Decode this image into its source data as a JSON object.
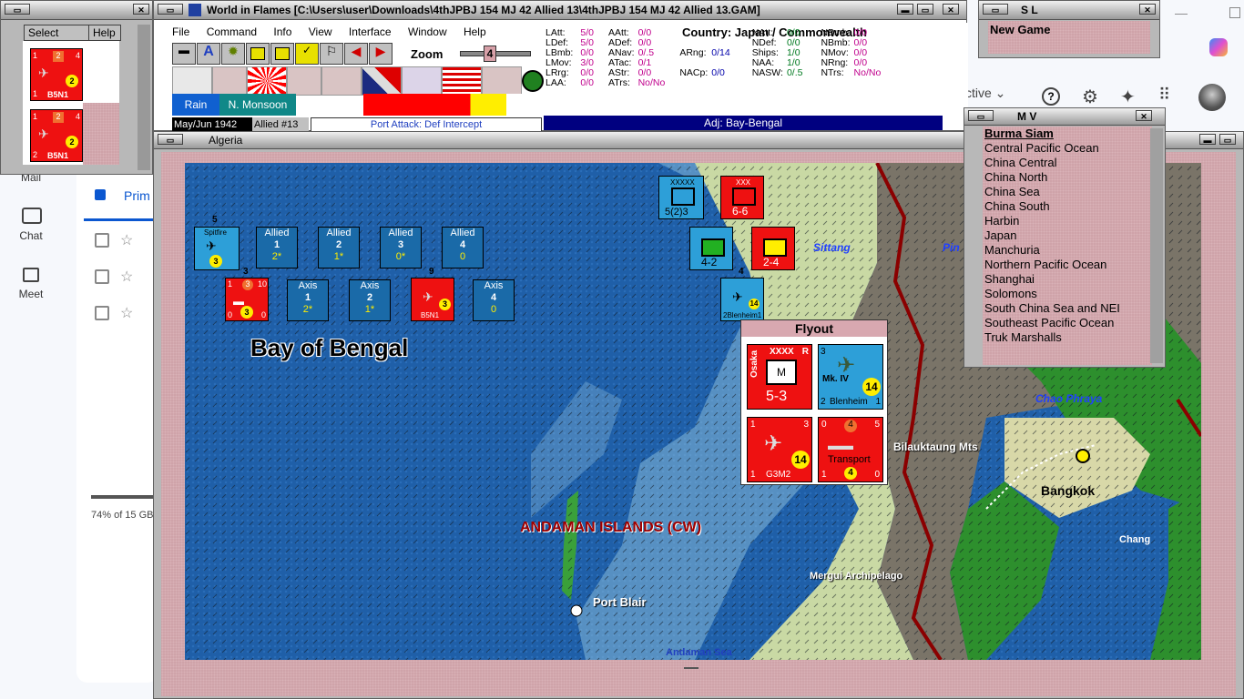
{
  "main_window": {
    "title": "World in Flames [C:\\Users\\user\\Downloads\\4thJPBJ 154 MJ 42 Allied 13\\4thJPBJ 154 MJ 42 Allied 13.GAM]",
    "menu": [
      "File",
      "Command",
      "Info",
      "View",
      "Interface",
      "Window",
      "Help"
    ],
    "zoom_label": "Zoom",
    "zoom_value": "4",
    "weather": "Rain",
    "season": "N. Monsoon",
    "date": "May/Jun 1942",
    "impulse": "Allied #13",
    "phase": "Port Attack: Def Intercept",
    "country_title": "Country: Japan / Commonwealth",
    "adj_text": "Adj: Bay-Bengal",
    "stats": [
      [
        "LAtt:",
        "5/0",
        "AAtt:",
        "0/0",
        "",
        "",
        "NAtt:",
        "0/0",
        "NBmb:",
        "0/0"
      ],
      [
        "LDef:",
        "5/0",
        "ADef:",
        "0/0",
        "",
        "",
        "NDef:",
        "0/0",
        "NBmb:",
        "0/0"
      ],
      [
        "LBmb:",
        "0/0",
        "ANav:",
        "0/.5",
        "ARng:",
        "0/14",
        "Ships:",
        "1/0",
        "NMov:",
        "0/0"
      ],
      [
        "LMov:",
        "3/0",
        "ATac:",
        "0/1",
        "",
        "",
        "NAA:",
        "1/0",
        "NRng:",
        "0/0"
      ],
      [
        "LRrg:",
        "0/0",
        "AStr:",
        "0/0",
        "NACp:",
        "0/0",
        "NASW:",
        "0/.5",
        "NTrs:",
        "No/No"
      ],
      [
        "LAA:",
        "0/0",
        "ATrs:",
        "No/No",
        "",
        "",
        "",
        "",
        "",
        ""
      ]
    ]
  },
  "select_window": {
    "select_label": "Select",
    "help_label": "Help",
    "units": [
      "B5N1",
      "B5N1"
    ]
  },
  "sl_window": {
    "title": "S L",
    "new_game": "New Game"
  },
  "mv_window": {
    "title": "M V",
    "items": [
      "Burma Siam",
      "Central Pacific Ocean",
      "China Central",
      "China North",
      "China Sea",
      "China South",
      "Harbin",
      "Japan",
      "Manchuria",
      "Northern Pacific Ocean",
      "Shanghai",
      "Solomons",
      "South China Sea and NEI",
      "Southeast Pacific Ocean",
      "Truk Marshalls"
    ]
  },
  "map_window": {
    "title": "Algeria",
    "sea_name": "Bay of Bengal",
    "islands": "ANDAMAN ISLANDS (CW)",
    "places": {
      "port_blair": "Port Blair",
      "mergui": "Mergui Archipelago",
      "andaman_sea": "Andaman Sea",
      "bangkok": "Bangkok",
      "chang": "Chang",
      "bilauktaung": "Bilauktaung Mts",
      "chao_phraya": "Chao Phraya",
      "sittang": "Sittang",
      "pin": "Pin"
    },
    "allied_boxes": [
      {
        "side": "Allied",
        "num": "1",
        "val": "2*"
      },
      {
        "side": "Allied",
        "num": "2",
        "val": "1*"
      },
      {
        "side": "Allied",
        "num": "3",
        "val": "0*"
      },
      {
        "side": "Allied",
        "num": "4",
        "val": "0"
      }
    ],
    "axis_boxes": [
      {
        "side": "Axis",
        "num": "1",
        "val": "2*"
      },
      {
        "side": "Axis",
        "num": "2",
        "val": "1*"
      },
      {
        "side": "Axis",
        "num": "4",
        "val": "0"
      }
    ],
    "counters": {
      "spitfire": "Spitfire",
      "spitfire_num": "3",
      "b5n1": "B5N1",
      "stack_5": "5",
      "stack_3": "3",
      "stack_9": "9",
      "hq_val": "5(2)3",
      "arm_val": "6-6",
      "inf1_val": "4-2",
      "inf2_val": "2-4",
      "blenheim_small": "2Blenheim1",
      "stack_4": "4"
    },
    "flyout": {
      "title": "Flyout",
      "osaka": "Osaka",
      "xxxx": "XXXX",
      "osaka_val": "5-3",
      "mk": "Mk. IV",
      "blenheim": "Blenheim",
      "blen_range": "14",
      "g3m2": "G3M2",
      "g3m2_range": "14",
      "transport": "Transport",
      "transport_val": "4"
    }
  },
  "gmail_bg": {
    "mail": "Mail",
    "chat": "Chat",
    "meet": "Meet",
    "primary": "Prim",
    "storage": "74% of 15 GB",
    "active": "ctive"
  }
}
